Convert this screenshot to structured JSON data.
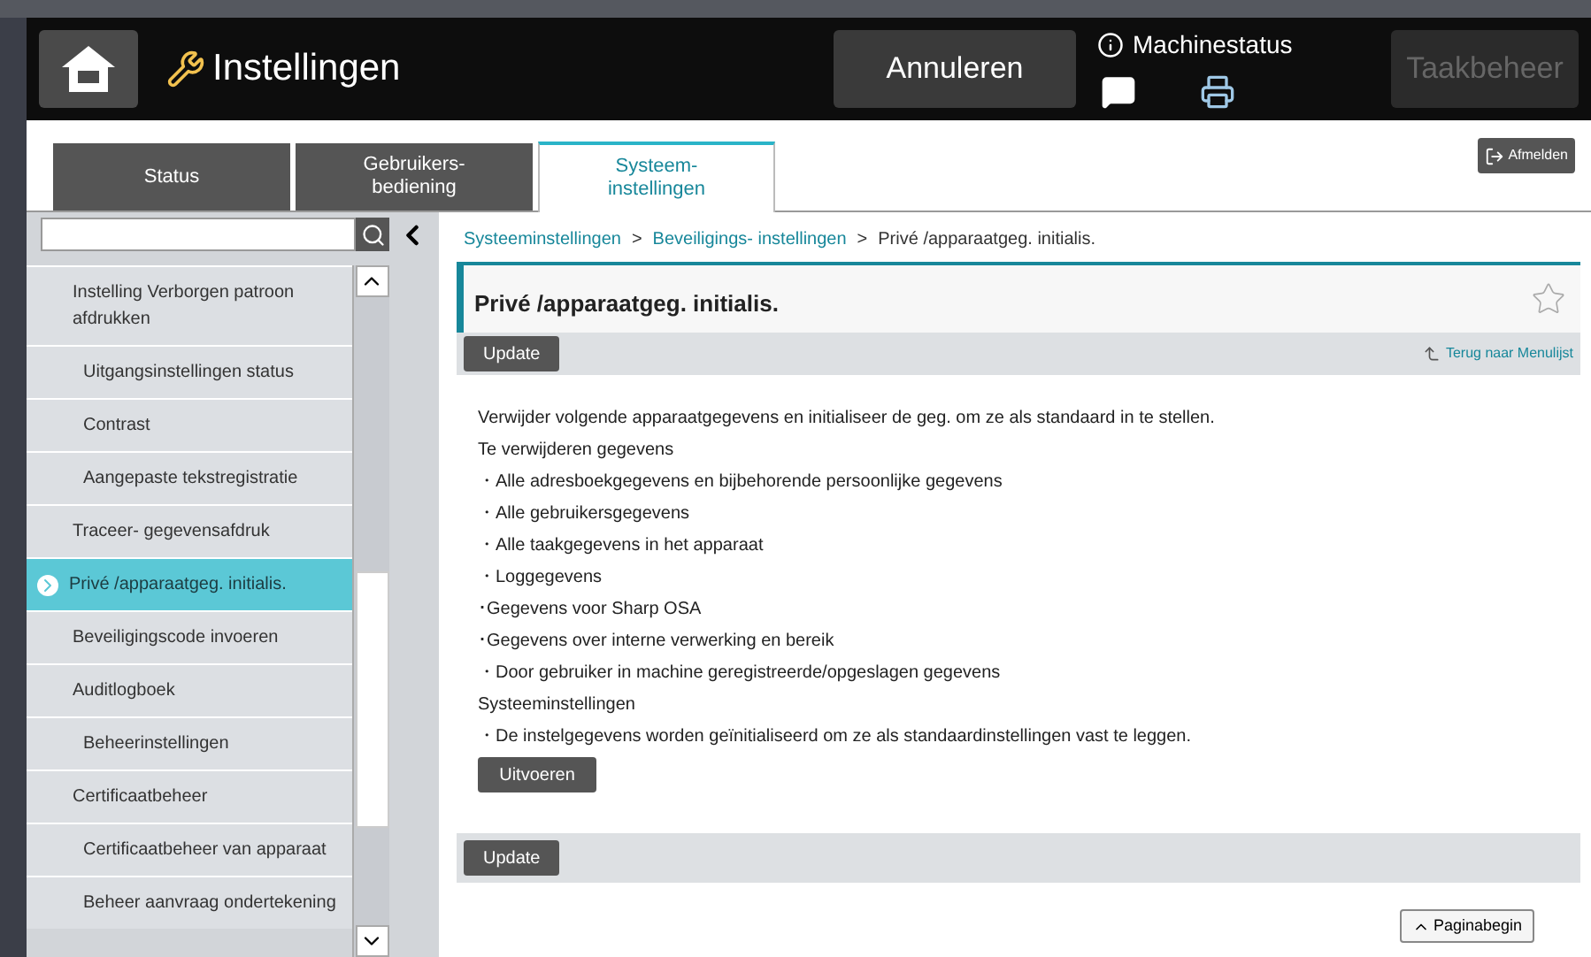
{
  "header": {
    "title": "Instellingen",
    "cancel_button": "Annuleren",
    "machine_status": "Machinestatus",
    "job_button": {
      "label": "Taakbeheer",
      "disabled": true
    }
  },
  "tabs": [
    {
      "label": "Status",
      "selected": false
    },
    {
      "label": "Gebruikers-\nbediening",
      "selected": false
    },
    {
      "label": "Systeem-\ninstellingen",
      "selected": true
    }
  ],
  "logout_button": "Afmelden",
  "sidebar": {
    "items": [
      {
        "label": "Instelling Verborgen patroon afdrukken",
        "kind": "top",
        "selected": false
      },
      {
        "label": "Uitgangsinstellingen status",
        "kind": "sub",
        "selected": false
      },
      {
        "label": "Contrast",
        "kind": "sub",
        "selected": false
      },
      {
        "label": "Aangepaste tekstregistratie",
        "kind": "sub",
        "selected": false
      },
      {
        "label": "Traceer- gegevensafdruk",
        "kind": "top",
        "selected": false
      },
      {
        "label": "Privé /apparaatgeg. initialis.",
        "kind": "top",
        "selected": true
      },
      {
        "label": "Beveiligingscode invoeren",
        "kind": "top",
        "selected": false
      },
      {
        "label": "Auditlogboek",
        "kind": "top",
        "selected": false
      },
      {
        "label": "Beheerinstellingen",
        "kind": "sub",
        "selected": false
      },
      {
        "label": "Certificaatbeheer",
        "kind": "top",
        "selected": false
      },
      {
        "label": "Certificaatbeheer van apparaat",
        "kind": "sub",
        "selected": false
      },
      {
        "label": "Beheer aanvraag ondertekening",
        "kind": "sub",
        "selected": false
      }
    ]
  },
  "breadcrumb": [
    {
      "label": "Systeeminstellingen",
      "kind": "link"
    },
    {
      "label": ">",
      "kind": "sep"
    },
    {
      "label": "Beveiligings- instellingen",
      "kind": "link"
    },
    {
      "label": ">",
      "kind": "sep"
    },
    {
      "label": "Privé /apparaatgeg. initialis.",
      "kind": "current"
    }
  ],
  "page_title": "Privé /apparaatgeg. initialis.",
  "update_button_top": "Update",
  "back_link": "Terug naar Menulijst",
  "body_lines": [
    "Verwijder volgende apparaatgegevens en initialiseer de geg. om ze als standaard in te stellen.",
    "Te verwijderen gegevens",
    "・Alle adresboekgegevens en bijbehorende persoonlijke gegevens",
    "・Alle gebruikersgegevens",
    "・Alle taakgegevens in het apparaat",
    "・Loggegevens",
    "･Gegevens voor Sharp OSA",
    "･Gegevens over interne verwerking en bereik",
    "・Door gebruiker in machine geregistreerde/opgeslagen gegevens",
    "Systeeminstellingen",
    "・De instelgegevens worden geïnitialiseerd om ze als standaardinstellingen vast te leggen."
  ],
  "execute_button": "Uitvoeren",
  "update_button_bottom": "Update",
  "top_of_page_button": "Paginabegin"
}
